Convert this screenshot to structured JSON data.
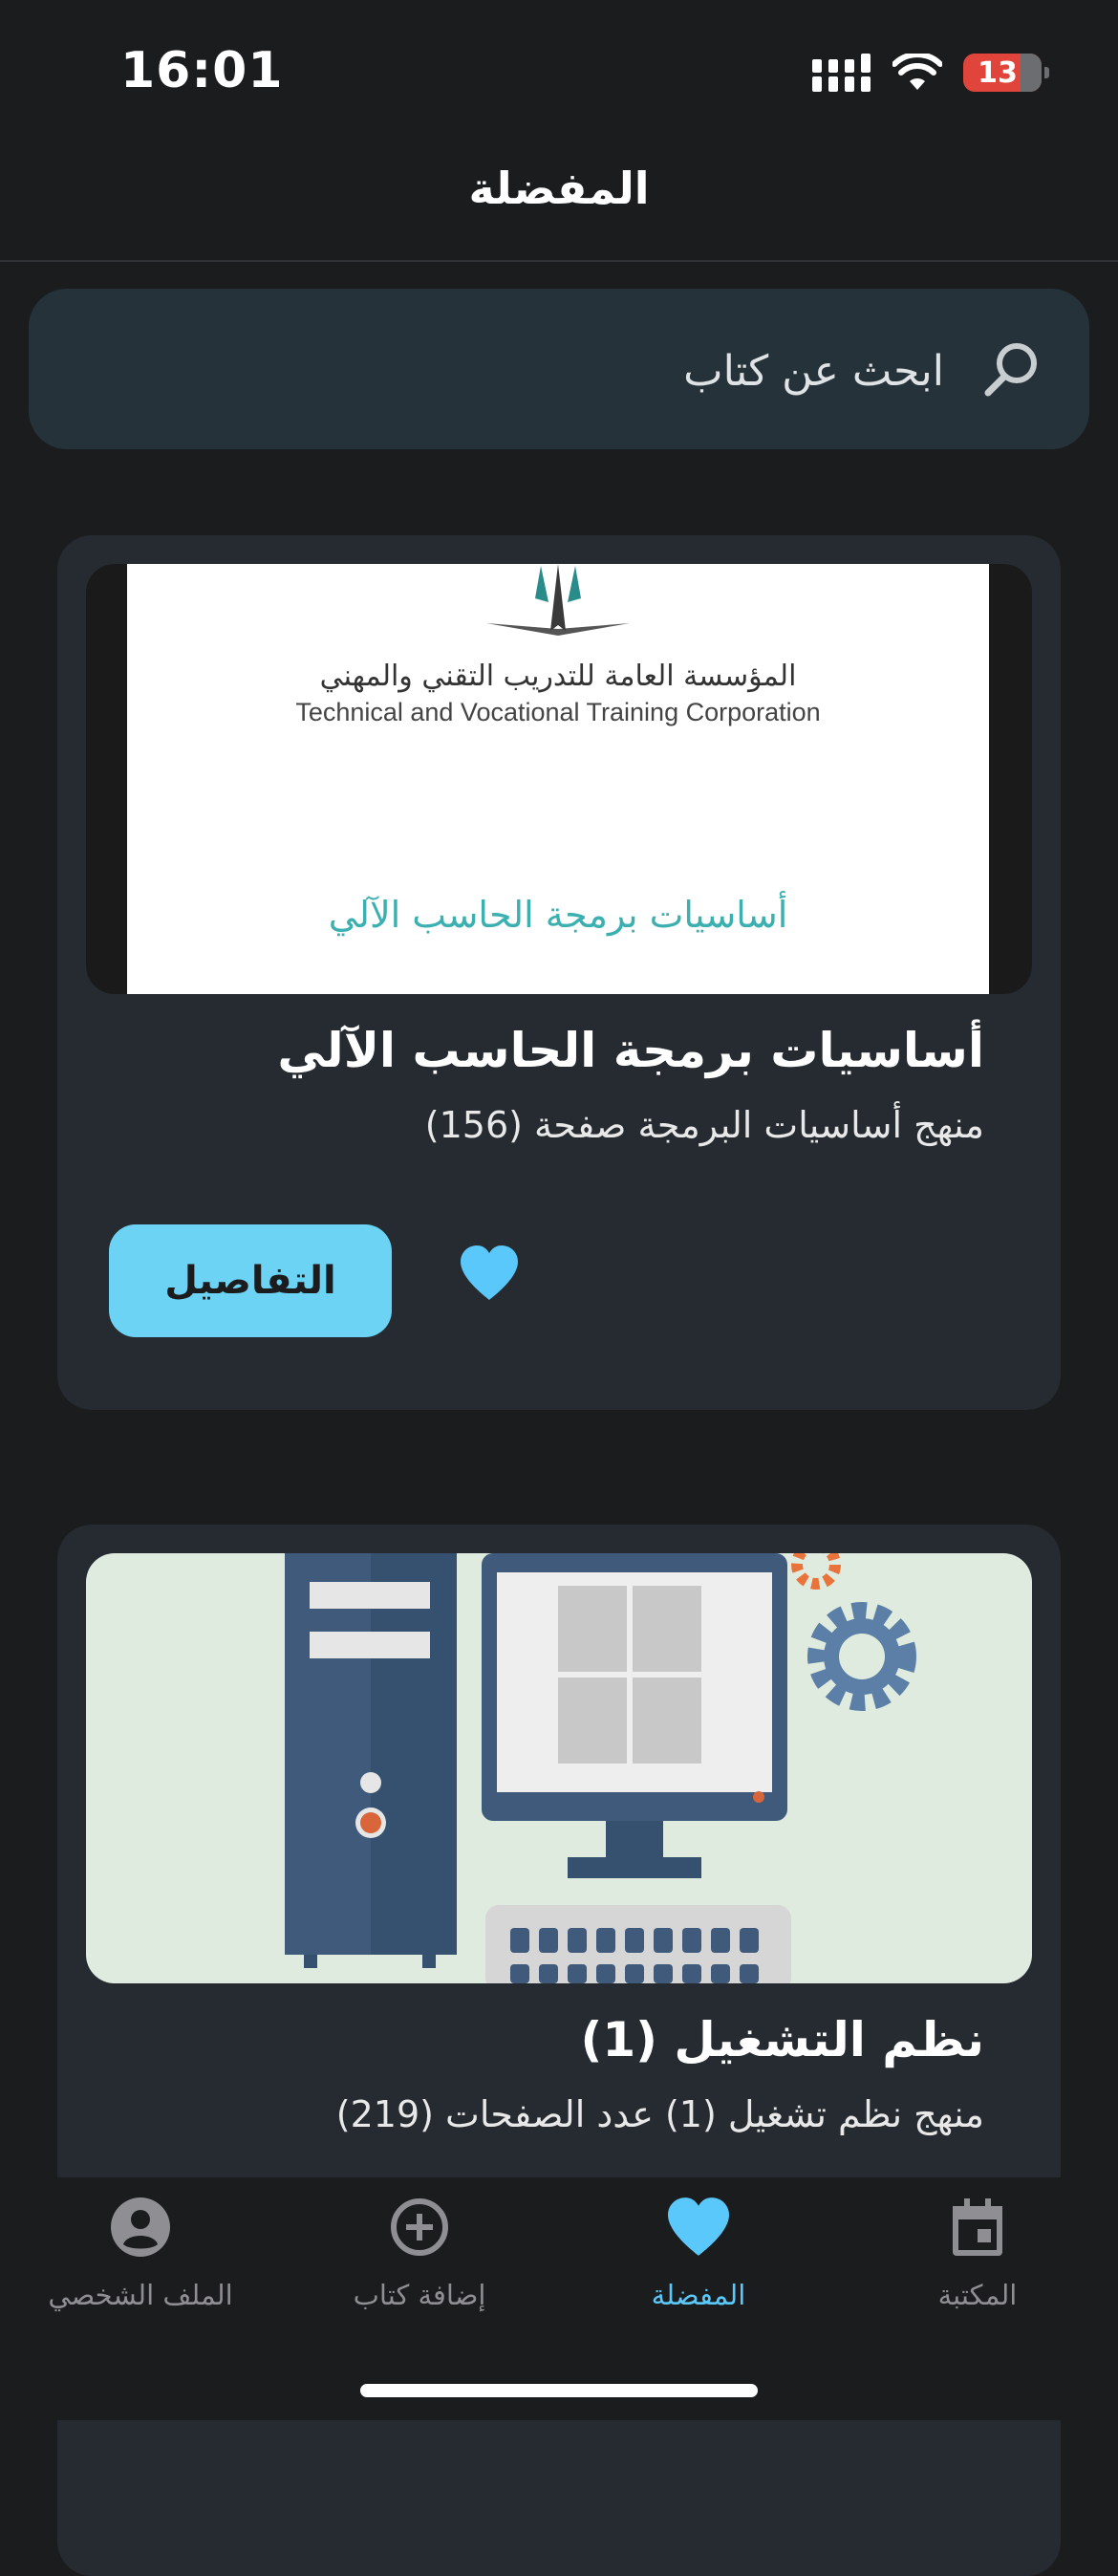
{
  "status_bar": {
    "time": "16:01",
    "battery": "13"
  },
  "header": {
    "title": "المفضلة"
  },
  "search": {
    "placeholder": "ابحث عن كتاب"
  },
  "books": [
    {
      "cover_org_ar": "المؤسسة العامة للتدريب التقني والمهني",
      "cover_org_en": "Technical and Vocational Training Corporation",
      "cover_title": "أساسيات برمجة الحاسب الآلي",
      "title": "أساسيات برمجة الحاسب الآلي",
      "subtitle": "منهج أساسيات البرمجة صفحة (156)",
      "details_label": "التفاصيل"
    },
    {
      "title": "نظم التشغيل (1)",
      "subtitle": "منهج نظم تشغيل (1) عدد الصفحات (219)"
    }
  ],
  "tabs": [
    {
      "label": "المكتبة",
      "icon": "calendar-icon"
    },
    {
      "label": "المفضلة",
      "icon": "heart-icon"
    },
    {
      "label": "إضافة كتاب",
      "icon": "plus-circle-icon"
    },
    {
      "label": "الملف الشخصي",
      "icon": "person-circle-icon"
    }
  ],
  "colors": {
    "accent": "#6dd3f5",
    "active_tab": "#5ac8fa",
    "background": "#1b1c1e",
    "card": "#252b31"
  }
}
